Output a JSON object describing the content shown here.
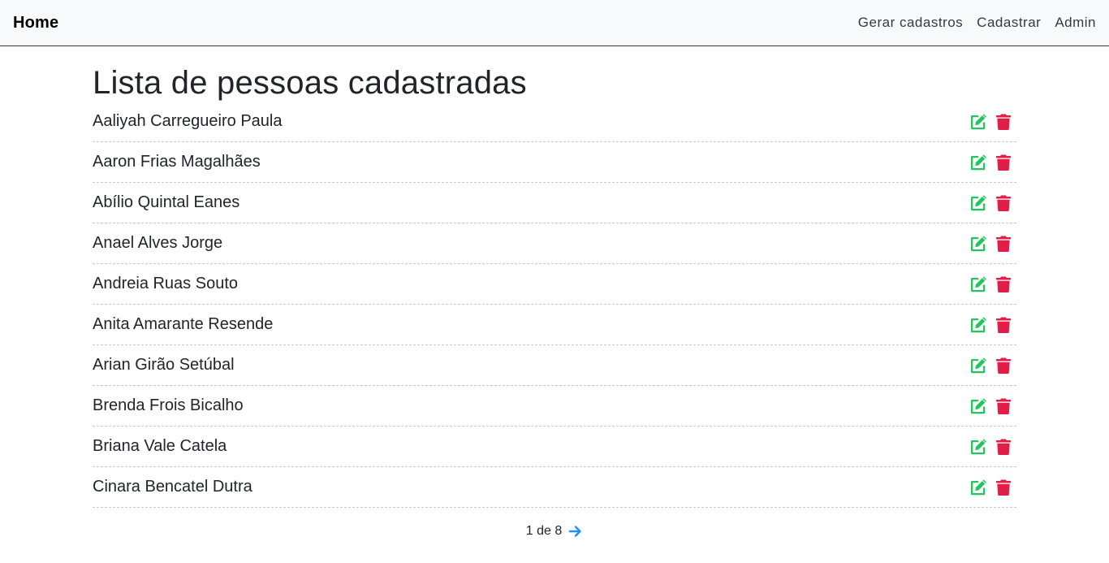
{
  "nav": {
    "brand": "Home",
    "links": [
      "Gerar cadastros",
      "Cadastrar",
      "Admin"
    ]
  },
  "page": {
    "title": "Lista de pessoas cadastradas"
  },
  "people": [
    "Aaliyah Carregueiro Paula",
    "Aaron Frias Magalhães",
    "Abílio Quintal Eanes",
    "Anael Alves Jorge",
    "Andreia Ruas Souto",
    "Anita Amarante Resende",
    "Arian Girão Setúbal",
    "Brenda Frois Bicalho",
    "Briana Vale Catela",
    "Cinara Bencatel Dutra"
  ],
  "row_icons": {
    "edit": "edit-icon",
    "delete": "trash-icon"
  },
  "colors": {
    "edit": "#22c55e",
    "delete": "#e11d48",
    "arrow": "#1e90ff"
  },
  "pagination": {
    "label": "1 de 8",
    "next_icon": "arrow-right-icon"
  }
}
